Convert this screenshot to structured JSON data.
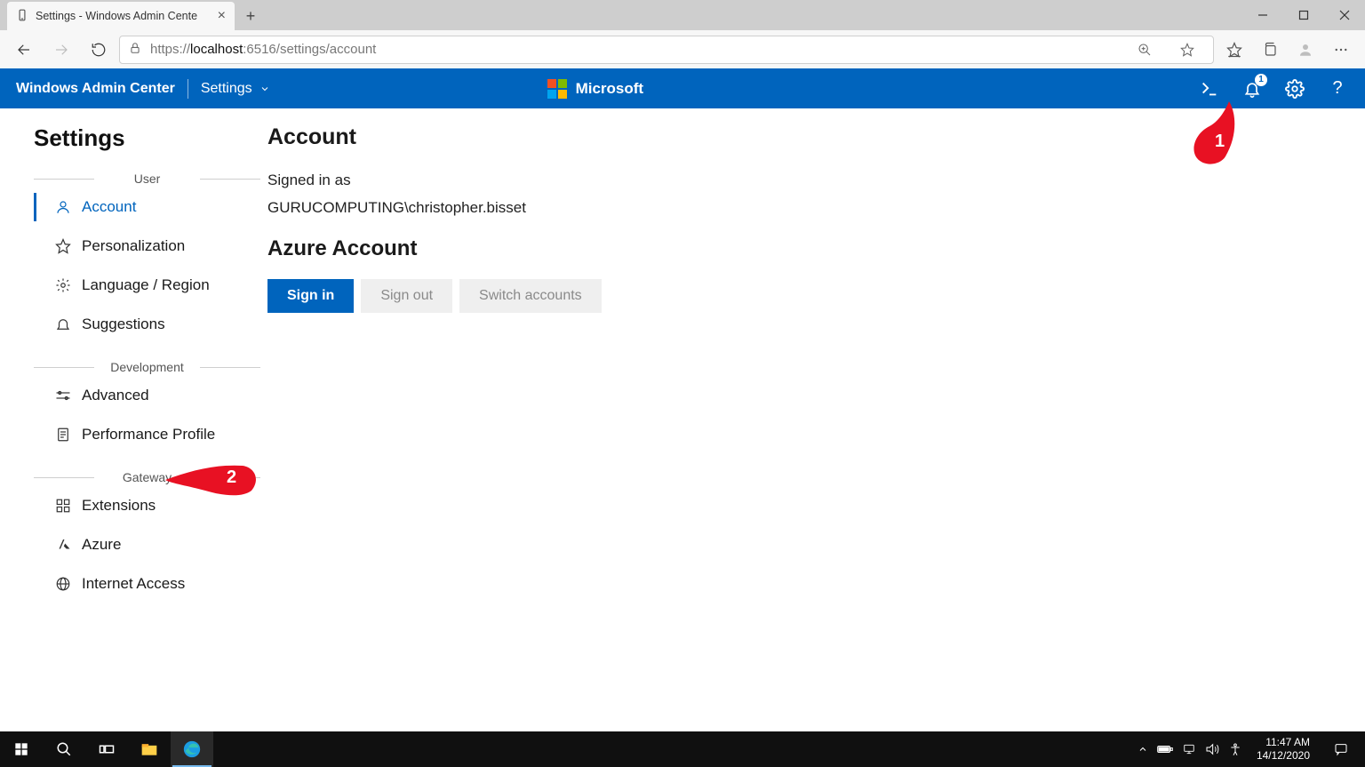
{
  "browser": {
    "tab_title": "Settings - Windows Admin Cente",
    "url_proto": "https://",
    "url_host": "localhost",
    "url_rest": ":6516/settings/account"
  },
  "header": {
    "brand": "Windows Admin Center",
    "crumb": "Settings",
    "ms_label": "Microsoft",
    "notification_count": "1"
  },
  "page": {
    "title": "Settings"
  },
  "sidebar": {
    "groups": [
      {
        "label": "User",
        "items": [
          {
            "label": "Account",
            "active": true
          },
          {
            "label": "Personalization"
          },
          {
            "label": "Language / Region"
          },
          {
            "label": "Suggestions"
          }
        ]
      },
      {
        "label": "Development",
        "items": [
          {
            "label": "Advanced"
          },
          {
            "label": "Performance Profile"
          }
        ]
      },
      {
        "label": "Gateway",
        "items": [
          {
            "label": "Extensions"
          },
          {
            "label": "Azure"
          },
          {
            "label": "Internet Access"
          }
        ]
      }
    ]
  },
  "main": {
    "account_heading": "Account",
    "signed_in_label": "Signed in as",
    "signed_in_user": "GURUCOMPUTING\\christopher.bisset",
    "azure_heading": "Azure Account",
    "btn_sign_in": "Sign in",
    "btn_sign_out": "Sign out",
    "btn_switch": "Switch accounts"
  },
  "callouts": {
    "c1": "1",
    "c2": "2"
  },
  "taskbar": {
    "time": "11:47 AM",
    "date": "14/12/2020"
  }
}
